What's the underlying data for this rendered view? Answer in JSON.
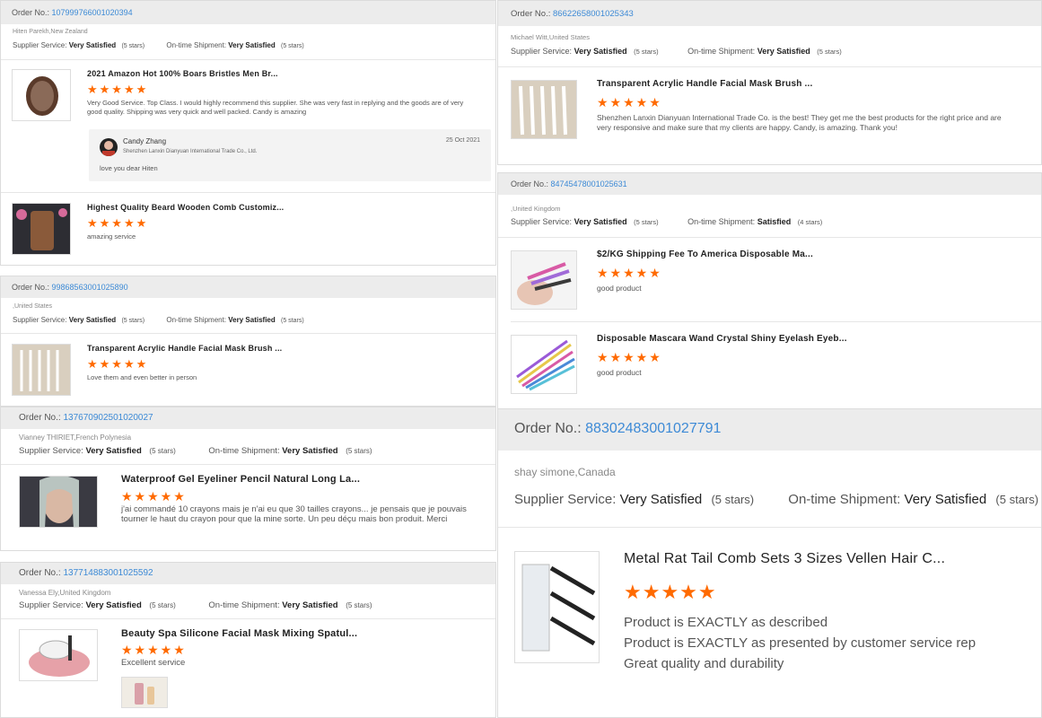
{
  "labels": {
    "order_no": "Order No.:",
    "supplier_service": "Supplier Service:",
    "ontime_shipment": "On-time Shipment:"
  },
  "colors": {
    "star": "#ff6a00",
    "order_link": "#3d8ad6",
    "header_bg": "#ececec"
  },
  "reviews": [
    {
      "order_no": "107999766001020394",
      "customer": "Hiten Parekh,New Zealand",
      "supplier_rating": "Very Satisfied",
      "supplier_stars": "(5 stars)",
      "shipment_rating": "Very Satisfied",
      "shipment_stars": "(5 stars)",
      "items": [
        {
          "name": "2021 Amazon Hot 100% Boars Bristles Men Br...",
          "stars": "★★★★★",
          "comment": "Very Good Service. Top Class. I would highly recommend this supplier. She was very fast in replying and the goods are of very good quality. Shipping was very quick and well packed. Candy is amazing",
          "reply": {
            "name": "Candy Zhang",
            "company": "Shenzhen Lanxin Dianyuan International Trade Co., Ltd.",
            "date": "25 Oct 2021",
            "text": "love you dear Hiten"
          }
        },
        {
          "name": "Highest Quality Beard Wooden Comb Customiz...",
          "stars": "★★★★★",
          "comment": "amazing service"
        }
      ]
    },
    {
      "order_no": "99868563001025890",
      "customer": ",United States",
      "supplier_rating": "Very Satisfied",
      "supplier_stars": "(5 stars)",
      "shipment_rating": "Very Satisfied",
      "shipment_stars": "(5 stars)",
      "items": [
        {
          "name": "Transparent Acrylic Handle Facial Mask Brush ...",
          "stars": "★★★★★",
          "comment": "Love them and even better in person"
        }
      ]
    },
    {
      "order_no": "137670902501020027",
      "customer": "Vianney THIRIET,French Polynesia",
      "supplier_rating": "Very Satisfied",
      "supplier_stars": "(5 stars)",
      "shipment_rating": "Very Satisfied",
      "shipment_stars": "(5 stars)",
      "items": [
        {
          "name": "Waterproof Gel Eyeliner Pencil Natural Long La...",
          "stars": "★★★★★",
          "comment": "j'ai commandé 10 crayons mais je n'ai eu que 30 tailles crayons... je pensais que je pouvais tourner le haut du crayon pour que la mine sorte. Un peu déçu mais bon produit. Merci"
        }
      ]
    },
    {
      "order_no": "137714883001025592",
      "customer": "Vanessa Ely,United Kingdom",
      "supplier_rating": "Very Satisfied",
      "supplier_stars": "(5 stars)",
      "shipment_rating": "Very Satisfied",
      "shipment_stars": "(5 stars)",
      "items": [
        {
          "name": "Beauty Spa Silicone Facial Mask Mixing Spatul...",
          "stars": "★★★★★",
          "comment": "Excellent service"
        }
      ]
    },
    {
      "order_no": "86622658001025343",
      "customer": "Michael Witt,United States",
      "supplier_rating": "Very Satisfied",
      "supplier_stars": "(5 stars)",
      "shipment_rating": "Very Satisfied",
      "shipment_stars": "(5 stars)",
      "items": [
        {
          "name": "Transparent Acrylic Handle Facial Mask Brush ...",
          "stars": "★★★★★",
          "comment": "Shenzhen Lanxin Dianyuan International Trade Co. is the best! They get me the best products for the right price and are very responsive and make sure that my clients are happy. Candy, is amazing. Thank you!"
        }
      ]
    },
    {
      "order_no": "84745478001025631",
      "customer": ",United Kingdom",
      "supplier_rating": "Very Satisfied",
      "supplier_stars": "(5 stars)",
      "shipment_rating": "Satisfied",
      "shipment_stars": "(4 stars)",
      "items": [
        {
          "name": "$2/KG Shipping Fee To America Disposable Ma...",
          "stars": "★★★★★",
          "comment": "good product"
        },
        {
          "name": "Disposable Mascara Wand Crystal Shiny Eyelash Eyeb...",
          "stars": "★★★★★",
          "comment": "good product"
        }
      ]
    },
    {
      "order_no": "88302483001027791",
      "customer": "shay simone,Canada",
      "supplier_rating": "Very Satisfied",
      "supplier_stars": "(5 stars)",
      "shipment_rating": "Very Satisfied",
      "shipment_stars": "(5 stars)",
      "items": [
        {
          "name": "Metal Rat Tail Comb Sets 3 Sizes Vellen Hair C...",
          "stars": "★★★★★",
          "comment_lines": [
            "Product is EXACTLY as described",
            "Product is EXACTLY as presented by customer service rep",
            "Great quality and durability"
          ]
        }
      ]
    }
  ]
}
